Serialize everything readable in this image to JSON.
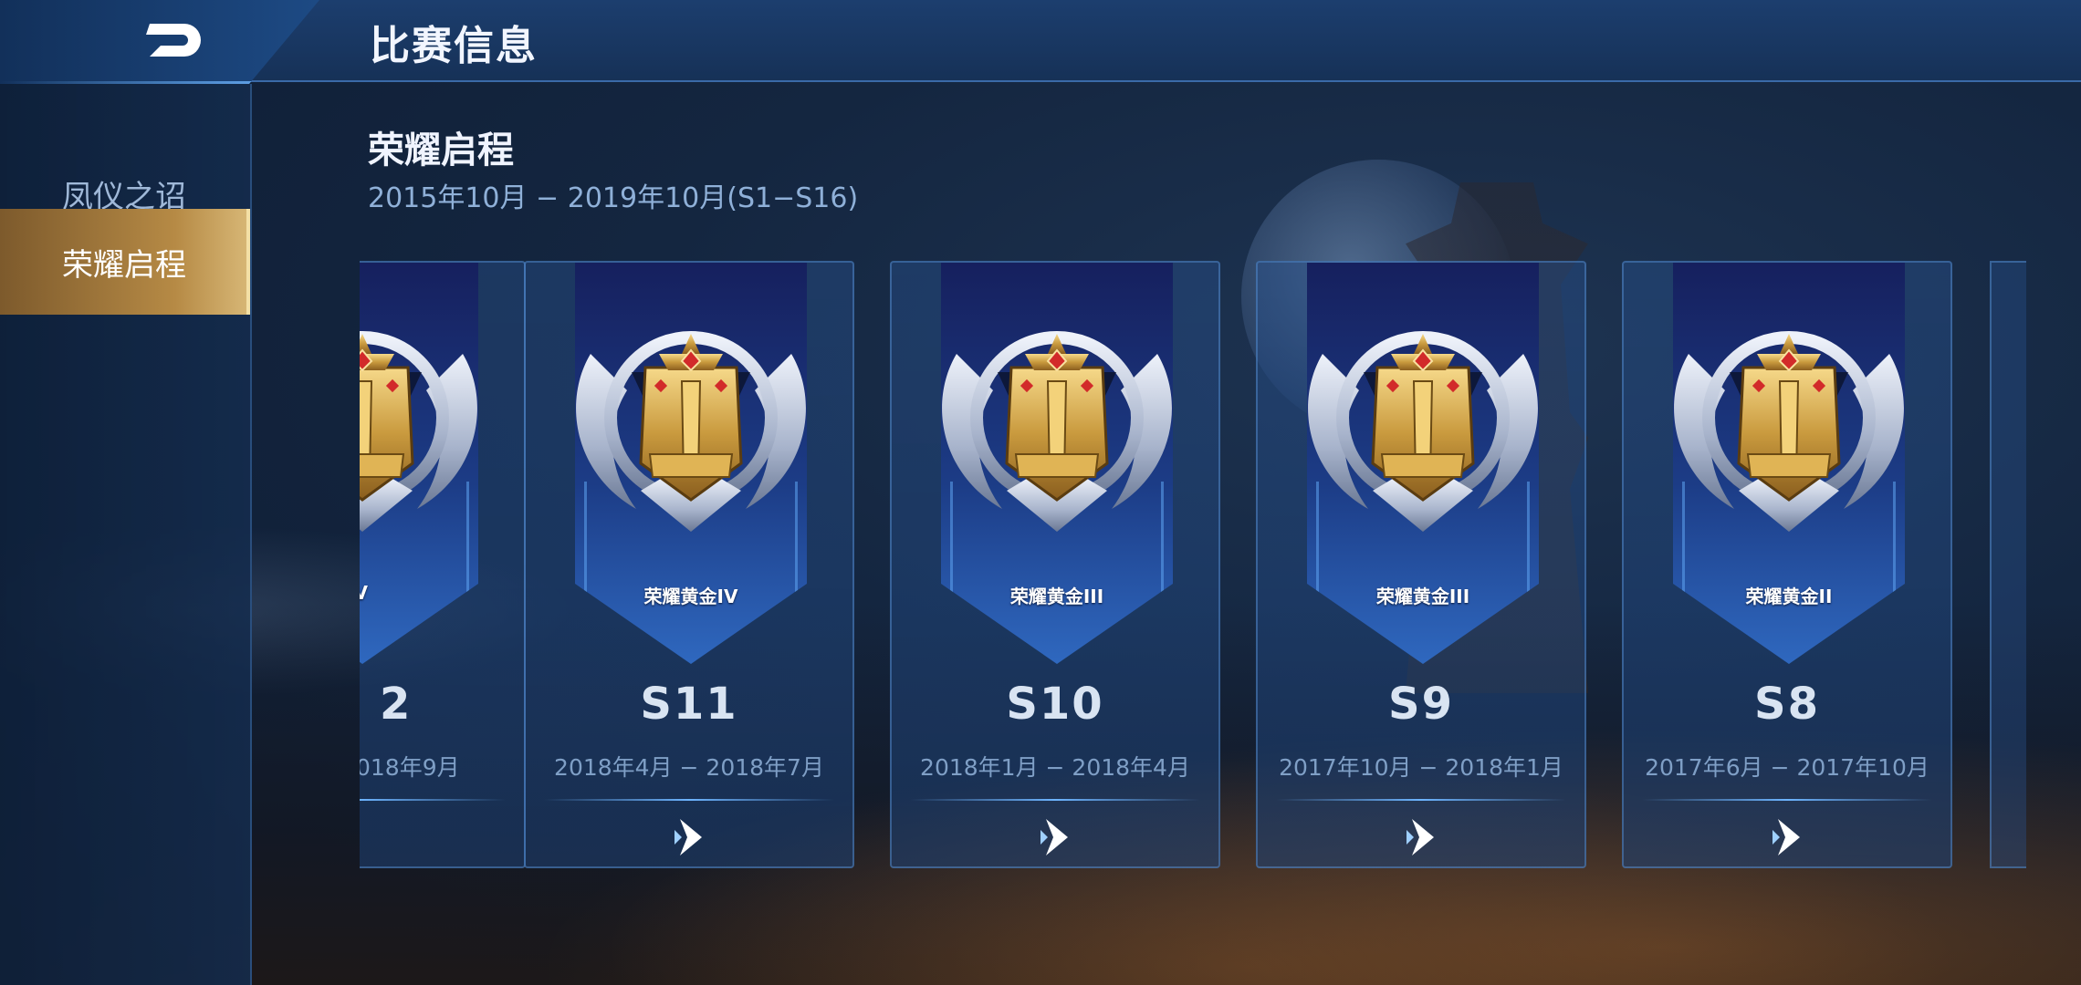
{
  "header": {
    "title": "比赛信息",
    "back_icon": "back-arrow-icon"
  },
  "sidebar": {
    "items": [
      {
        "label": "凤仪之诏",
        "selected": false
      },
      {
        "label": "荣耀启程",
        "selected": true
      }
    ]
  },
  "section": {
    "title": "荣耀启程",
    "subtitle": "2015年10月 − 2019年10月(S1−S16)"
  },
  "cards": [
    {
      "rank": "IV",
      "season": "2",
      "dates": "018年9月",
      "partial": true
    },
    {
      "rank": "荣耀黄金IV",
      "numeral": "IV",
      "season": "S11",
      "dates": "2018年4月 − 2018年7月"
    },
    {
      "rank": "荣耀黄金III",
      "numeral": "III",
      "season": "S10",
      "dates": "2018年1月 − 2018年4月"
    },
    {
      "rank": "荣耀黄金III",
      "numeral": "III",
      "season": "S9",
      "dates": "2017年10月 − 2018年1月"
    },
    {
      "rank": "荣耀黄金II",
      "numeral": "II",
      "season": "S8",
      "dates": "2017年6月 − 2017年10月"
    }
  ],
  "colors": {
    "accent_gold": "#b68a45",
    "header_blue": "#1c3e6e",
    "card_date": "#7f9fc6"
  }
}
